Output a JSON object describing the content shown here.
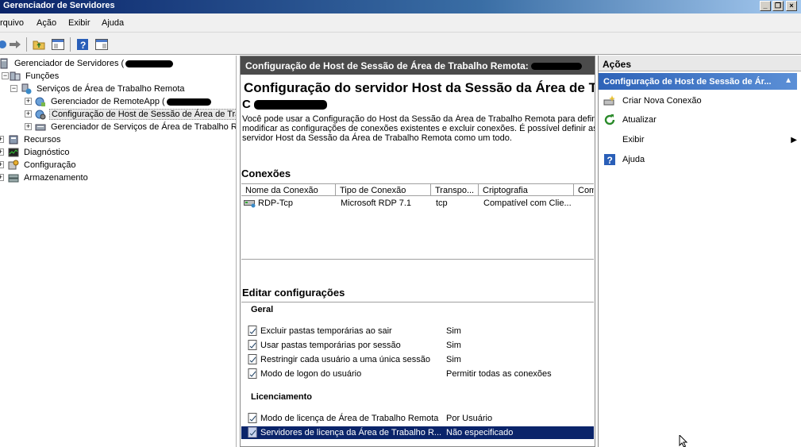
{
  "window": {
    "title": "Gerenciador de Servidores"
  },
  "menu": [
    "rquivo",
    "Ação",
    "Exibir",
    "Ajuda"
  ],
  "tree": {
    "root": "Gerenciador de Servidores (",
    "funcoes": "Funções",
    "rds": "Serviços de Área de Trabalho Remota",
    "remoteapp": "Gerenciador de RemoteApp (",
    "hostconfig": "Configuração de Host de Sessão de Área de Tra",
    "rdsmanager": "Gerenciador de Serviços de Área de Trabalho Re",
    "recursos": "Recursos",
    "diagnostico": "Diagnóstico",
    "configuracao": "Configuração",
    "armazenamento": "Armazenamento"
  },
  "center": {
    "header": "Configuração de Host de Sessão de Área de Trabalho Remota:",
    "title": "Configuração do servidor Host da Sessão da Área de T",
    "title2": "C",
    "description": [
      "Você pode usar a Configuração do Host da Sessão da Área de Trabalho Remota para definir a",
      "modificar as configurações de conexões existentes e excluir conexões. É possível definir as c",
      "servidor Host da Sessão da Área de Trabalho Remota como um todo."
    ],
    "connections_title": "Conexões",
    "columns": [
      "Nome da Conexão",
      "Tipo de Conexão",
      "Transpo...",
      "Criptografia",
      "Com"
    ],
    "connection_row": {
      "name": "RDP-Tcp",
      "type": "Microsoft RDP 7.1",
      "transport": "tcp",
      "crypto": "Compatível com Clie..."
    },
    "edit_title": "Editar configurações",
    "group_general": "Geral",
    "general": [
      {
        "k": "Excluir pastas temporárias ao sair",
        "v": "Sim"
      },
      {
        "k": "Usar pastas temporárias por sessão",
        "v": "Sim"
      },
      {
        "k": "Restringir cada usuário a uma única sessão",
        "v": "Sim"
      },
      {
        "k": "Modo de logon do usuário",
        "v": "Permitir todas as conexões"
      }
    ],
    "group_licensing": "Licenciamento",
    "licensing": [
      {
        "k": "Modo de licença de Área de Trabalho Remota",
        "v": "Por Usuário"
      },
      {
        "k": "Servidores de licença da Área de Trabalho R...",
        "v": "Não especificado"
      }
    ]
  },
  "actions": {
    "title": "Ações",
    "subheader": "Configuração de Host de Sessão de Ár...",
    "items": [
      "Criar Nova Conexão",
      "Atualizar",
      "Exibir",
      "Ajuda"
    ]
  }
}
